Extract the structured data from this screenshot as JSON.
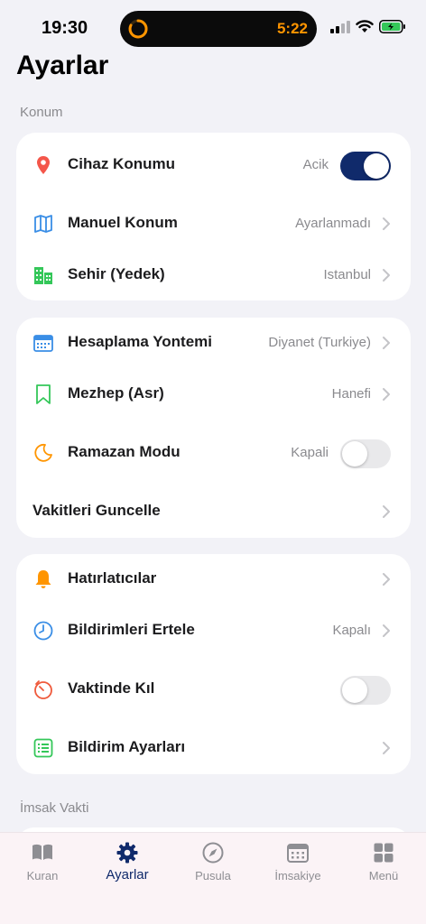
{
  "status": {
    "time": "19:30",
    "timer": "5:22"
  },
  "page": {
    "title": "Ayarlar"
  },
  "sections": {
    "konum": "Konum",
    "imsak": "İmsak Vakti"
  },
  "card1": {
    "cihaz_konumu": {
      "label": "Cihaz Konumu",
      "value": "Acik",
      "enabled": true
    },
    "manuel_konum": {
      "label": "Manuel Konum",
      "value": "Ayarlanmadı"
    },
    "sehir": {
      "label": "Sehir (Yedek)",
      "value": "Istanbul"
    }
  },
  "card2": {
    "hesaplama": {
      "label": "Hesaplama Yontemi",
      "value": "Diyanet (Turkiye)"
    },
    "mezhep": {
      "label": "Mezhep (Asr)",
      "value": "Hanefi"
    },
    "ramazan": {
      "label": "Ramazan Modu",
      "value": "Kapali",
      "enabled": false
    },
    "guncelle": {
      "label": "Vakitleri Guncelle"
    }
  },
  "card3": {
    "hatirlaticilar": {
      "label": "Hatırlatıcılar"
    },
    "ertele": {
      "label": "Bildirimleri Ertele",
      "value": "Kapalı"
    },
    "vaktinde": {
      "label": "Vaktinde Kıl",
      "enabled": false
    },
    "bildirim_ayarlari": {
      "label": "Bildirim Ayarları"
    }
  },
  "tabs": [
    {
      "label": "Kuran",
      "icon": "book-icon"
    },
    {
      "label": "Ayarlar",
      "icon": "gear-icon",
      "active": true
    },
    {
      "label": "Pusula",
      "icon": "compass-icon"
    },
    {
      "label": "İmsakiye",
      "icon": "calendar-icon"
    },
    {
      "label": "Menü",
      "icon": "grid-icon"
    }
  ],
  "colors": {
    "accent": "#102a6b",
    "background": "#f2f2f7",
    "location_red": "#f4564a",
    "map_blue": "#3a8ee6",
    "green": "#34c759",
    "orange": "#ff9500",
    "timer_red": "#ef5a3c"
  }
}
